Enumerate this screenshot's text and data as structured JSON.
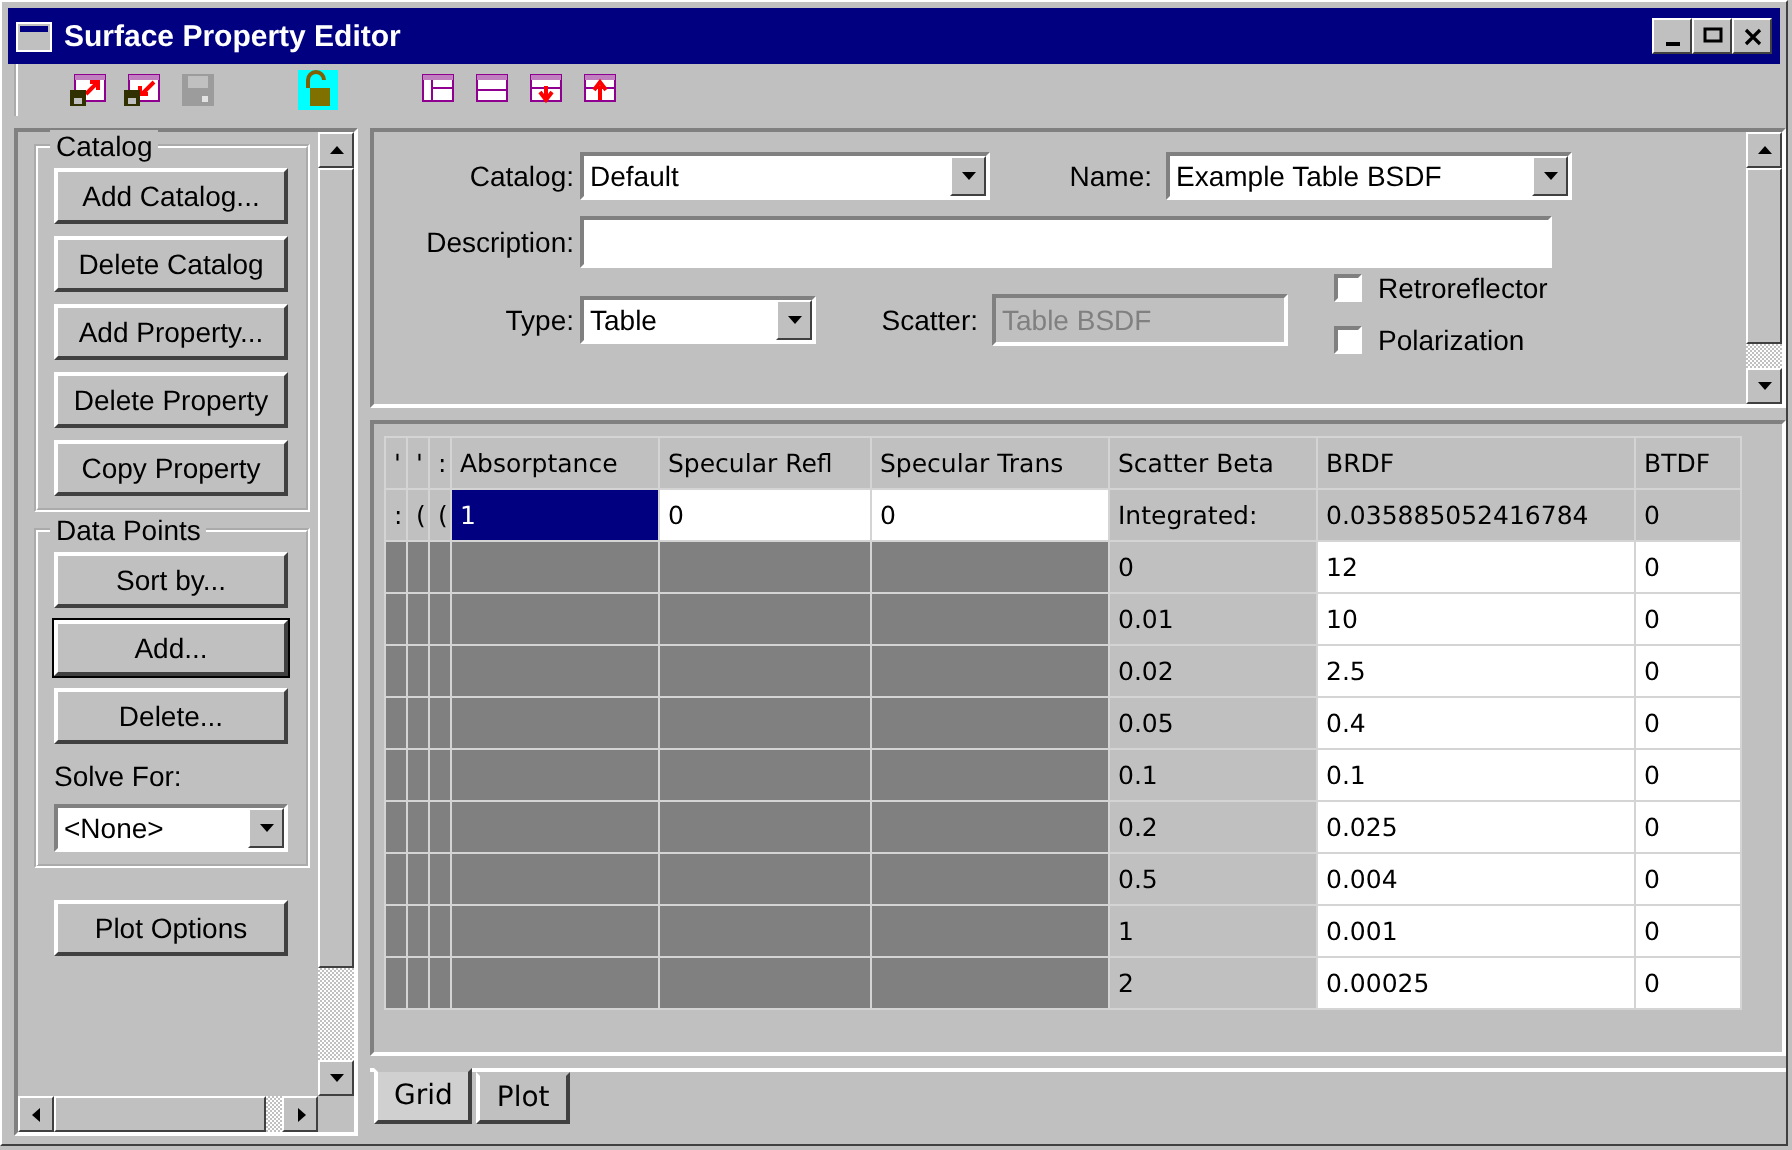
{
  "window": {
    "title": "Surface Property Editor"
  },
  "toolbar": [
    {
      "kind": "export",
      "disabled": false
    },
    {
      "kind": "import",
      "disabled": false
    },
    {
      "kind": "save",
      "disabled": true
    },
    {
      "kind": "gap"
    },
    {
      "kind": "lock",
      "disabled": false
    },
    {
      "kind": "gap"
    },
    {
      "kind": "table-left",
      "disabled": false
    },
    {
      "kind": "table-rows",
      "disabled": false
    },
    {
      "kind": "table-down",
      "disabled": false
    },
    {
      "kind": "table-up",
      "disabled": false
    }
  ],
  "sidebar": {
    "groups": [
      {
        "title": "Catalog",
        "buttons": [
          {
            "label": "Add Catalog...",
            "default": false
          },
          {
            "label": "Delete Catalog",
            "default": false
          },
          {
            "label": "Add Property...",
            "default": false
          },
          {
            "label": "Delete Property",
            "default": false
          },
          {
            "label": "Copy Property",
            "default": false
          }
        ]
      },
      {
        "title": "Data Points",
        "buttons": [
          {
            "label": "Sort by...",
            "default": false
          },
          {
            "label": "Add...",
            "default": true
          },
          {
            "label": "Delete...",
            "default": false
          }
        ],
        "solve_for": {
          "label": "Solve For:",
          "value": "<None>"
        }
      }
    ],
    "plot_options": {
      "label": "Plot Options"
    }
  },
  "form": {
    "catalog": {
      "label": "Catalog:",
      "value": "Default"
    },
    "name": {
      "label": "Name:",
      "value": "Example Table BSDF"
    },
    "description": {
      "label": "Description:"
    },
    "type": {
      "label": "Type:",
      "value": "Table"
    },
    "scatter": {
      "label": "Scatter:",
      "value": "Table BSDF",
      "disabled": true
    },
    "checkboxes": [
      {
        "label": "Retroreflector",
        "checked": false
      },
      {
        "label": "Polarization",
        "checked": false
      }
    ]
  },
  "grid": {
    "stub_headers": [
      "'",
      "'",
      ":"
    ],
    "columns": [
      "Absorptance",
      "Specular Refl",
      "Specular Trans",
      "Scatter Beta",
      "BRDF",
      "BTDF"
    ],
    "rows": [
      {
        "kind": "integrated",
        "stubs": [
          ":",
          "(",
          "("
        ],
        "cells": [
          {
            "text": "1",
            "selected": true
          },
          {
            "text": "0",
            "selected": false
          },
          {
            "text": "0",
            "selected": false
          }
        ],
        "scatter_beta": "Integrated:",
        "brdf": "0.035885052416784",
        "btdf": "0"
      },
      {
        "kind": "point",
        "scatter_beta": "0",
        "brdf": "12",
        "btdf": "0"
      },
      {
        "kind": "point",
        "scatter_beta": "0.01",
        "brdf": "10",
        "btdf": "0"
      },
      {
        "kind": "point",
        "scatter_beta": "0.02",
        "brdf": "2.5",
        "btdf": "0"
      },
      {
        "kind": "point",
        "scatter_beta": "0.05",
        "brdf": "0.4",
        "btdf": "0"
      },
      {
        "kind": "point",
        "scatter_beta": "0.1",
        "brdf": "0.1",
        "btdf": "0"
      },
      {
        "kind": "point",
        "scatter_beta": "0.2",
        "brdf": "0.025",
        "btdf": "0"
      },
      {
        "kind": "point",
        "scatter_beta": "0.5",
        "brdf": "0.004",
        "btdf": "0"
      },
      {
        "kind": "point",
        "scatter_beta": "1",
        "brdf": "0.001",
        "btdf": "0"
      },
      {
        "kind": "point",
        "scatter_beta": "2",
        "brdf": "0.00025",
        "btdf": "0"
      }
    ]
  },
  "tabs": [
    {
      "label": "Grid",
      "selected": true
    },
    {
      "label": "Plot",
      "selected": false
    }
  ]
}
